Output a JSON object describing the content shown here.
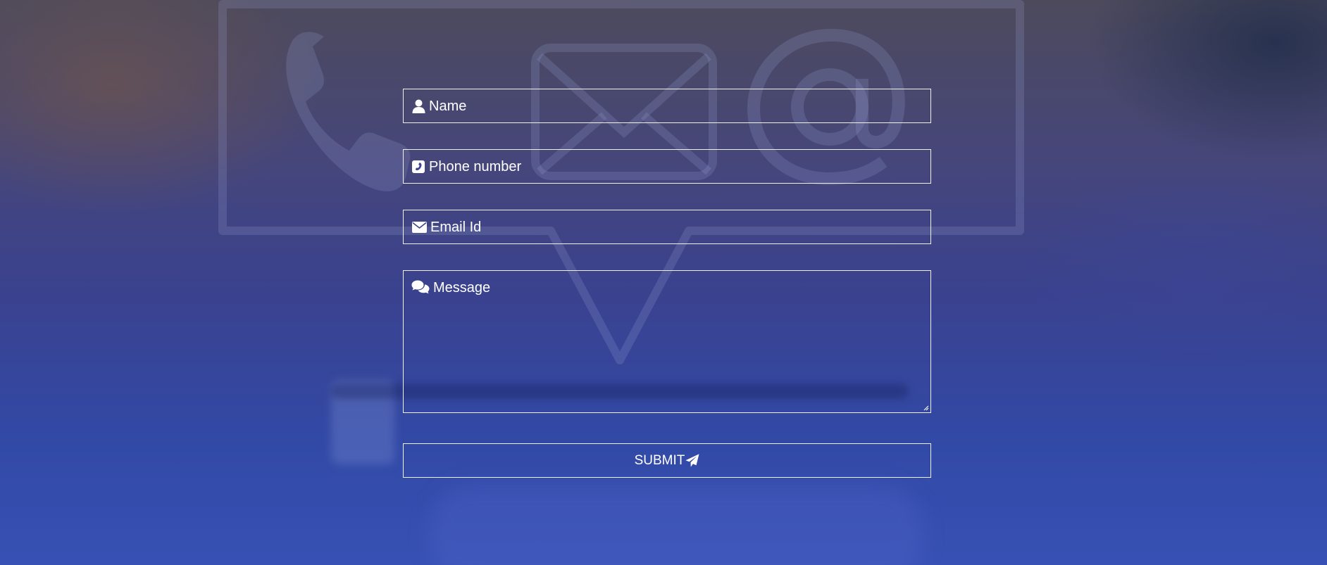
{
  "theme": {
    "text_color": "#ffffff",
    "border_color": "#ffffff",
    "background_top": "#4d4a5c",
    "background_bottom": "#3751b4"
  },
  "background": {
    "watermark_icons": [
      "phone-icon",
      "envelope-icon",
      "at-sign-icon",
      "speech-bubble-outline"
    ]
  },
  "form": {
    "fields": [
      {
        "icon": "user-icon",
        "placeholder": "Name"
      },
      {
        "icon": "phone-square-icon",
        "placeholder": "Phone number"
      },
      {
        "icon": "envelope-icon",
        "placeholder": "Email Id"
      },
      {
        "icon": "comments-icon",
        "placeholder": "Message"
      }
    ],
    "submit": {
      "label": "SUBMIT",
      "icon": "paper-plane-icon"
    }
  }
}
